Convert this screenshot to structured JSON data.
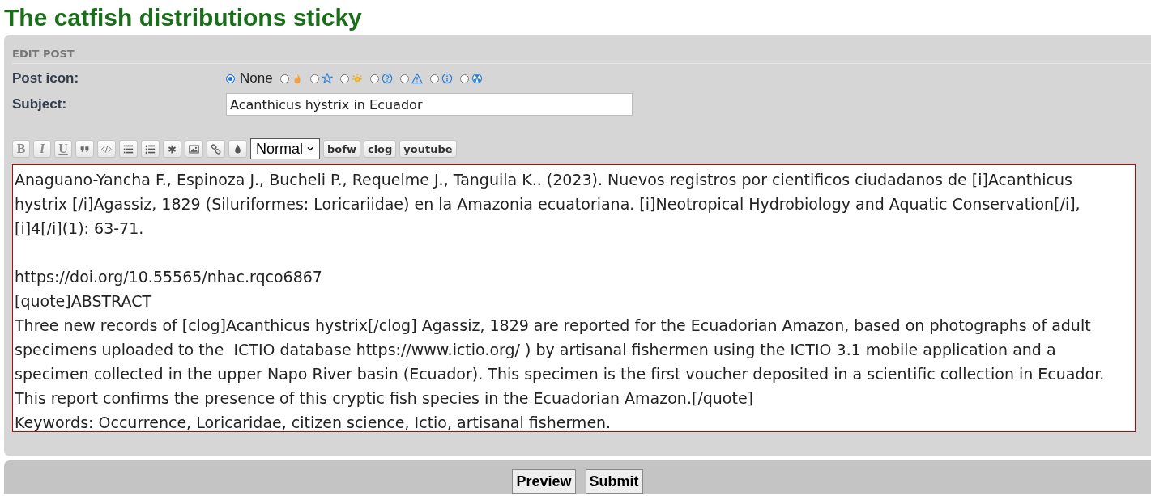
{
  "page_title": "The catfish distributions sticky",
  "panel": {
    "heading": "EDIT POST"
  },
  "post_icon": {
    "label": "Post icon:",
    "options": [
      {
        "kind": "none",
        "label": "None",
        "selected": true
      },
      {
        "kind": "fire",
        "selected": false
      },
      {
        "kind": "star",
        "selected": false
      },
      {
        "kind": "sun",
        "selected": false
      },
      {
        "kind": "question",
        "selected": false
      },
      {
        "kind": "warning",
        "selected": false
      },
      {
        "kind": "info",
        "selected": false
      },
      {
        "kind": "radiation",
        "selected": false
      }
    ]
  },
  "subject": {
    "label": "Subject:",
    "value": "Acanthicus hystrix in Ecuador"
  },
  "toolbar": {
    "buttons": [
      {
        "kind": "bold",
        "text": "B"
      },
      {
        "kind": "italic",
        "text": "I"
      },
      {
        "kind": "underline",
        "text": "U"
      },
      {
        "kind": "quote"
      },
      {
        "kind": "code"
      },
      {
        "kind": "list"
      },
      {
        "kind": "ordered-list"
      },
      {
        "kind": "asterisk"
      },
      {
        "kind": "image"
      },
      {
        "kind": "link"
      },
      {
        "kind": "drop"
      }
    ],
    "size_select": "Normal",
    "custom_buttons": [
      "bofw",
      "clog",
      "youtube"
    ]
  },
  "message_paragraphs": [
    [
      "Anaguano-Yancha F., Espinoza J., Bucheli P., Requelme J., Tanguila K.. (2023). Nuevos registros por cientificos ciudadanos de [i]Acanthicus",
      "hystrix [/i]Agassiz, 1829 (Siluriformes: Loricariidae) en la Amazonia ecuatoriana. [i]Neotropical Hydrobiology and Aquatic Conservation[/i],",
      "[i]4[/i](1): 63-71."
    ],
    [
      "https://doi.org/10.55565/nhac.rqco6867",
      "[quote]ABSTRACT",
      "Three new records of [clog]Acanthicus hystrix[/clog] Agassiz, 1829 are reported for the Ecuadorian Amazon, based on photographs of adult",
      "specimens uploaded to the  ICTIO database https://www.ictio.org/ ) by artisanal fishermen using the ICTIO 3.1 mobile application and a",
      "specimen collected in the upper Napo River basin (Ecuador). This specimen is the first voucher deposited in a scientific collection in Ecuador.",
      "This report confirms the presence of this cryptic fish species in the Ecuadorian Amazon.[/quote]",
      "Keywords: Occurrence, Loricaridae, citizen science, Ictio, artisanal fishermen."
    ]
  ],
  "actions": [
    "Preview",
    "Submit"
  ]
}
